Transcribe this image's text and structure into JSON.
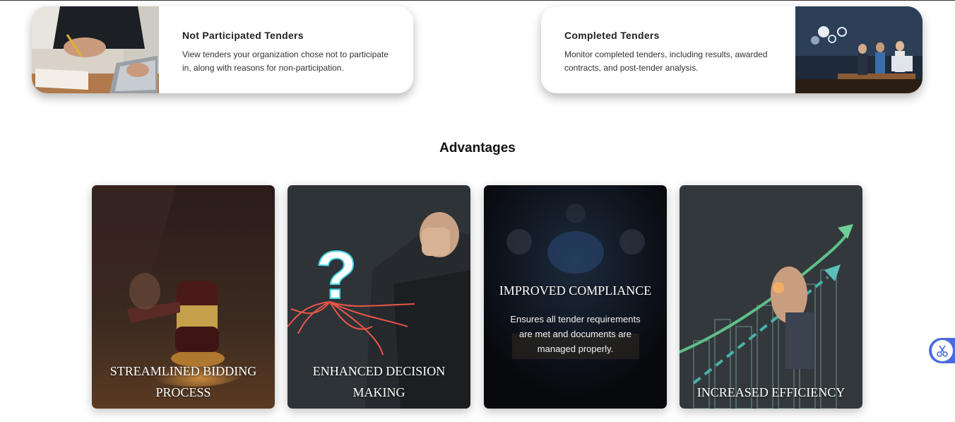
{
  "top_cards": [
    {
      "title": "Not Participated Tenders",
      "description": "View tenders your organization chose not to participate in, along with reasons for non-participation."
    },
    {
      "title": "Completed Tenders",
      "description": "Monitor completed tenders, including results, awarded contracts, and post-tender analysis."
    }
  ],
  "advantages": {
    "heading": "Advantages",
    "cards": [
      {
        "line1": "STREAMLINED BIDDING",
        "line2": "PROCESS"
      },
      {
        "line1": "ENHANCED DECISION",
        "line2": "MAKING"
      },
      {
        "title": "IMPROVED COMPLIANCE",
        "description_lines": [
          "Ensures all tender requirements",
          "are met and documents are",
          "managed properly."
        ]
      },
      {
        "title": "INCREASED EFFICIENCY"
      }
    ]
  },
  "floating_button": {
    "icon": "scissors-icon",
    "color": "#4b6be0"
  }
}
